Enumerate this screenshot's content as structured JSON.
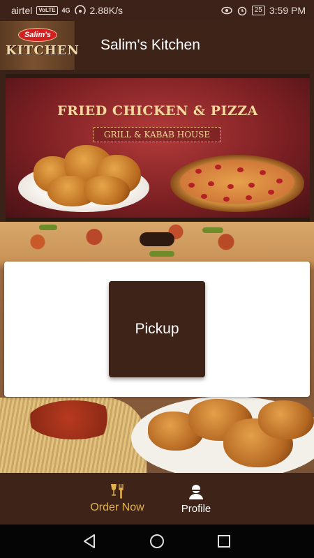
{
  "status_bar": {
    "carrier": "airtel",
    "volte_badge": "VoLTE",
    "network_badge": "4G",
    "speed": "2.88K/s",
    "battery": "25",
    "time": "3:59 PM"
  },
  "header": {
    "logo_badge": "Salim's",
    "logo_text": "KITCHEN",
    "title": "Salim's Kitchen"
  },
  "banner": {
    "title": "FRIED CHICKEN & PIZZA",
    "subtitle": "GRILL & KABAB HOUSE"
  },
  "card": {
    "pickup_label": "Pickup"
  },
  "bottom_nav": {
    "order_now_label": "Order Now",
    "profile_label": "Profile",
    "order_now_icon": "wine-fork-icon",
    "profile_icon": "user-icon",
    "active_color": "#e3b24b"
  },
  "system_nav": {
    "back_icon": "back-triangle-icon",
    "home_icon": "home-circle-icon",
    "recents_icon": "recents-square-icon"
  }
}
